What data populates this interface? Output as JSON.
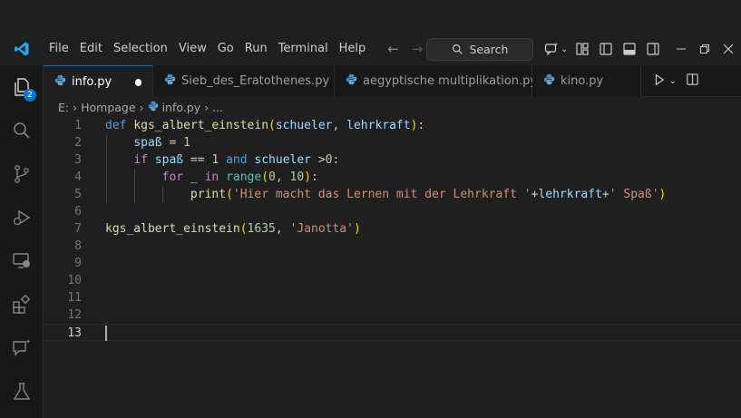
{
  "menu": [
    "File",
    "Edit",
    "Selection",
    "View",
    "Go",
    "Run",
    "Terminal",
    "Help"
  ],
  "search": {
    "label": "Search"
  },
  "activity": {
    "explorer_badge": "2"
  },
  "tabs": [
    {
      "label": "info.py",
      "active": true,
      "dirty": true
    },
    {
      "label": "Sieb_des_Eratothenes.py",
      "active": false
    },
    {
      "label": "aegyptische multiplikation.py",
      "active": false
    },
    {
      "label": "kino.py",
      "active": false
    }
  ],
  "breadcrumb": {
    "drive": "E:",
    "folder": "Hompage",
    "file": "info.py",
    "more": "..."
  },
  "editor": {
    "line_numbers": [
      "1",
      "2",
      "3",
      "4",
      "5",
      "6",
      "7",
      "8",
      "9",
      "10",
      "11",
      "12",
      "13"
    ],
    "current_line": "13",
    "code_lines": [
      "def kgs_albert_einstein(schueler, lehrkraft):",
      "    spaß = 1",
      "    if spaß == 1 and schueler >0:",
      "        for _ in range(0, 10):",
      "            print('Hier macht das Lernen mit der Lehrkraft '+lehrkraft+' Spaß')",
      "",
      "kgs_albert_einstein(1635, 'Janotta')",
      "",
      "",
      "",
      "",
      "",
      ""
    ]
  },
  "colors": {
    "accent": "#0078d4",
    "keyword": "#569cd6",
    "function": "#dcdcaa",
    "string": "#ce9178",
    "number": "#b5cea8"
  }
}
